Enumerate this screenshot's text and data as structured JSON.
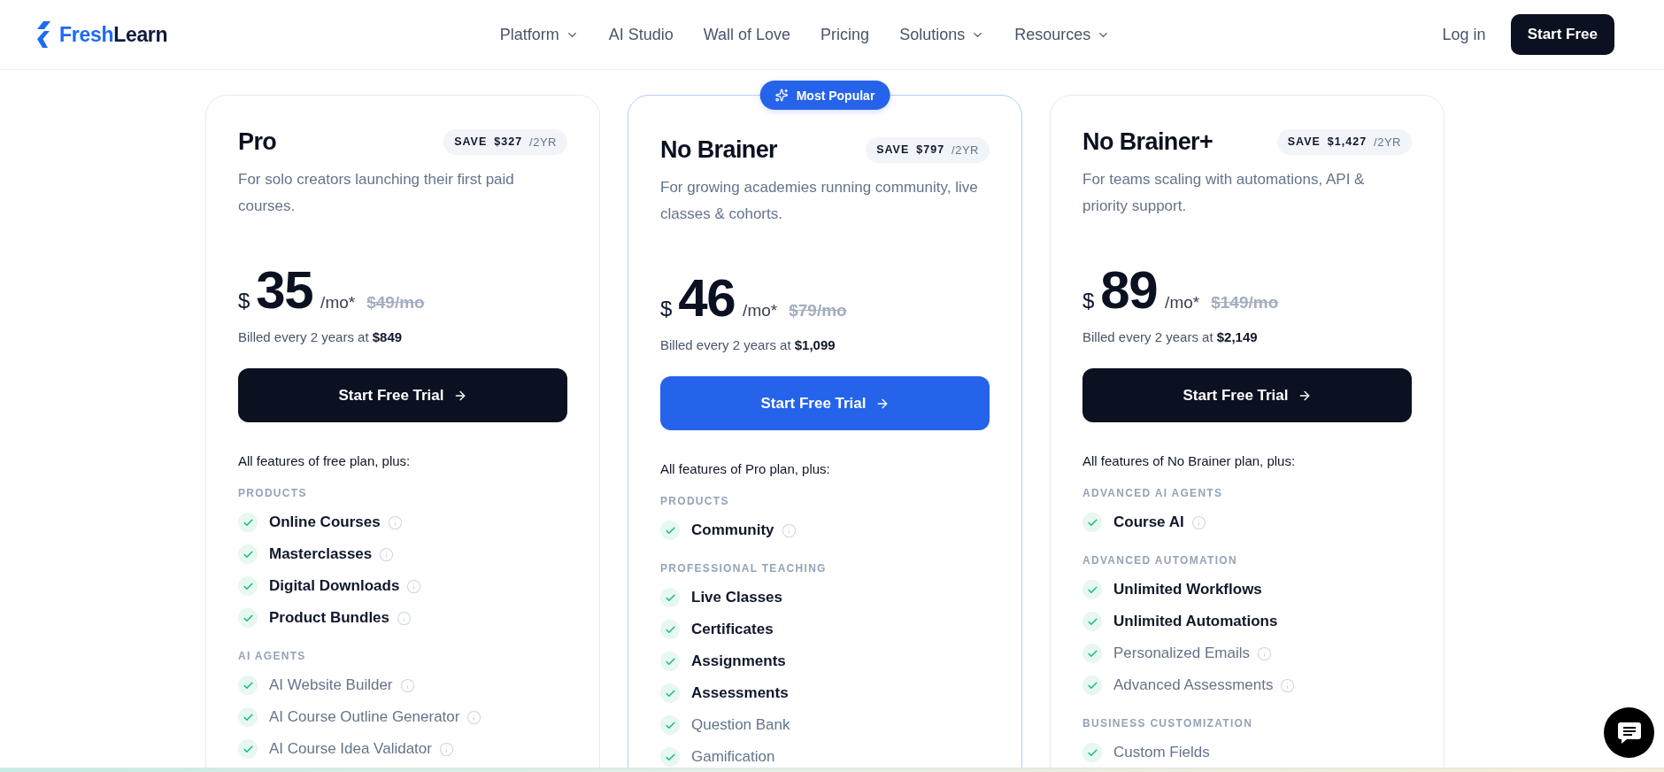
{
  "header": {
    "logo": {
      "text_primary": "Fresh",
      "text_secondary": "Learn"
    },
    "nav": [
      {
        "label": "Platform",
        "dropdown": true
      },
      {
        "label": "AI Studio",
        "dropdown": false
      },
      {
        "label": "Wall of Love",
        "dropdown": false
      },
      {
        "label": "Pricing",
        "dropdown": false
      },
      {
        "label": "Solutions",
        "dropdown": true
      },
      {
        "label": "Resources",
        "dropdown": true
      }
    ],
    "login": "Log in",
    "cta": "Start Free"
  },
  "plans": [
    {
      "name": "Pro",
      "featured": false,
      "savings": {
        "label": "SAVE",
        "amount": "$327",
        "period": "/2YR"
      },
      "description": "For solo creators launching their first paid courses.",
      "price": {
        "currency": "$",
        "amount": "35",
        "period": "/mo*",
        "original": "$49/mo"
      },
      "billing": "Billed every 2 years at **$849**",
      "button": "Start Free Trial",
      "features_intro": "All features of free plan, plus:",
      "groups": [
        {
          "title": "PRODUCTS",
          "items": [
            {
              "label": "Online Courses",
              "highlighted": true,
              "info": true
            },
            {
              "label": "Masterclasses",
              "highlighted": true,
              "info": true
            },
            {
              "label": "Digital Downloads",
              "highlighted": true,
              "info": true
            },
            {
              "label": "Product Bundles",
              "highlighted": true,
              "info": true
            }
          ]
        },
        {
          "title": "AI AGENTS",
          "items": [
            {
              "label": "AI Website Builder",
              "highlighted": false,
              "info": true
            },
            {
              "label": "AI Course Outline Generator",
              "highlighted": false,
              "info": true
            },
            {
              "label": "AI Course Idea Validator",
              "highlighted": false,
              "info": true
            }
          ]
        }
      ]
    },
    {
      "name": "No Brainer",
      "featured": true,
      "ribbon": "Most Popular",
      "savings": {
        "label": "SAVE",
        "amount": "$797",
        "period": "/2YR"
      },
      "description": "For growing academies running community, live classes & cohorts.",
      "price": {
        "currency": "$",
        "amount": "46",
        "period": "/mo*",
        "original": "$79/mo"
      },
      "billing": "Billed every 2 years at **$1,099**",
      "button": "Start Free Trial",
      "features_intro": "All features of Pro plan, plus:",
      "groups": [
        {
          "title": "PRODUCTS",
          "items": [
            {
              "label": "Community",
              "highlighted": true,
              "info": true
            }
          ]
        },
        {
          "title": "PROFESSIONAL TEACHING",
          "items": [
            {
              "label": "Live Classes",
              "highlighted": true,
              "info": false
            },
            {
              "label": "Certificates",
              "highlighted": true,
              "info": false
            },
            {
              "label": "Assignments",
              "highlighted": true,
              "info": false
            },
            {
              "label": "Assessments",
              "highlighted": true,
              "info": false
            },
            {
              "label": "Question Bank",
              "highlighted": false,
              "info": false
            },
            {
              "label": "Gamification",
              "highlighted": false,
              "info": false
            }
          ]
        }
      ]
    },
    {
      "name": "No Brainer+",
      "featured": false,
      "savings": {
        "label": "SAVE",
        "amount": "$1,427",
        "period": "/2YR"
      },
      "description": "For teams scaling with automations, API & priority support.",
      "price": {
        "currency": "$",
        "amount": "89",
        "period": "/mo*",
        "original": "$149/mo"
      },
      "billing": "Billed every 2 years at **$2,149**",
      "button": "Start Free Trial",
      "features_intro": "All features of No Brainer plan, plus:",
      "groups": [
        {
          "title": "ADVANCED AI AGENTS",
          "items": [
            {
              "label": "Course AI",
              "highlighted": true,
              "info": true
            }
          ]
        },
        {
          "title": "ADVANCED AUTOMATION",
          "items": [
            {
              "label": "Unlimited Workflows",
              "highlighted": true,
              "info": false
            },
            {
              "label": "Unlimited Automations",
              "highlighted": true,
              "info": false
            },
            {
              "label": "Personalized Emails",
              "highlighted": false,
              "info": true
            },
            {
              "label": "Advanced Assessments",
              "highlighted": false,
              "info": true
            }
          ]
        },
        {
          "title": "BUSINESS CUSTOMIZATION",
          "items": [
            {
              "label": "Custom Fields",
              "highlighted": false,
              "info": false
            }
          ]
        }
      ]
    }
  ]
}
